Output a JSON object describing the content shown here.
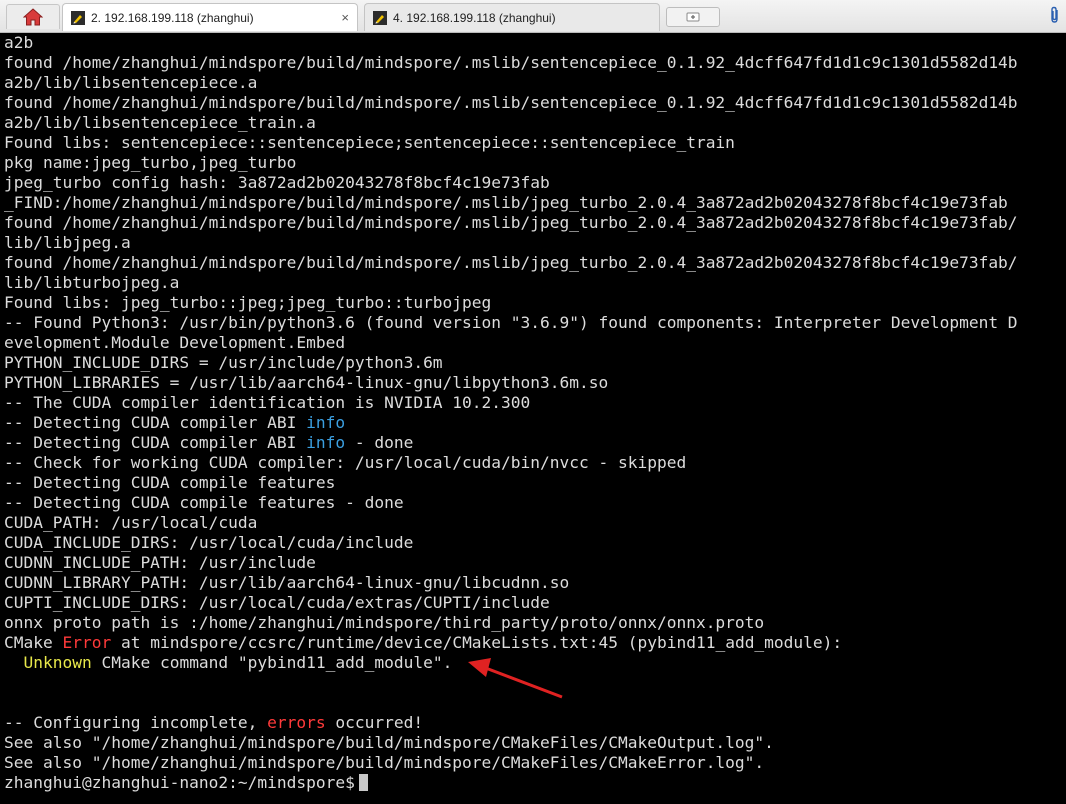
{
  "tabs": [
    {
      "label": "2. 192.168.199.118 (zhanghui)",
      "active": true,
      "close": "×"
    },
    {
      "label": "4. 192.168.199.118 (zhanghui)",
      "active": false
    }
  ],
  "icons": {
    "home": "home-icon",
    "session": "pencil-session-icon",
    "new_tab": "new-tab-icon",
    "attach": "paperclip-icon"
  },
  "colors": {
    "background": "#000000",
    "foreground": "#dcdcdc",
    "info": "#3b9fe0",
    "error": "#ff3a3a",
    "warning": "#e8e84a",
    "arrow": "#e02222"
  },
  "terminal": {
    "lines": [
      "a2b",
      "found /home/zhanghui/mindspore/build/mindspore/.mslib/sentencepiece_0.1.92_4dcff647fd1d1c9c1301d5582d14b",
      "a2b/lib/libsentencepiece.a",
      "found /home/zhanghui/mindspore/build/mindspore/.mslib/sentencepiece_0.1.92_4dcff647fd1d1c9c1301d5582d14b",
      "a2b/lib/libsentencepiece_train.a",
      "Found libs: sentencepiece::sentencepiece;sentencepiece::sentencepiece_train",
      "pkg name:jpeg_turbo,jpeg_turbo",
      "jpeg_turbo config hash: 3a872ad2b02043278f8bcf4c19e73fab",
      "_FIND:/home/zhanghui/mindspore/build/mindspore/.mslib/jpeg_turbo_2.0.4_3a872ad2b02043278f8bcf4c19e73fab",
      "found /home/zhanghui/mindspore/build/mindspore/.mslib/jpeg_turbo_2.0.4_3a872ad2b02043278f8bcf4c19e73fab/",
      "lib/libjpeg.a",
      "found /home/zhanghui/mindspore/build/mindspore/.mslib/jpeg_turbo_2.0.4_3a872ad2b02043278f8bcf4c19e73fab/",
      "lib/libturbojpeg.a",
      "Found libs: jpeg_turbo::jpeg;jpeg_turbo::turbojpeg",
      "-- Found Python3: /usr/bin/python3.6 (found version \"3.6.9\") found components: Interpreter Development D",
      "evelopment.Module Development.Embed",
      "PYTHON_INCLUDE_DIRS = /usr/include/python3.6m",
      "PYTHON_LIBRARIES = /usr/lib/aarch64-linux-gnu/libpython3.6m.so",
      "-- The CUDA compiler identification is NVIDIA 10.2.300"
    ],
    "abi_line": {
      "prefix": "-- Detecting CUDA compiler ABI ",
      "keyword": "info",
      "suffix": ""
    },
    "abi_done_line": {
      "prefix": "-- Detecting CUDA compiler ABI ",
      "keyword": "info",
      "suffix": " - done"
    },
    "lines2": [
      "-- Check for working CUDA compiler: /usr/local/cuda/bin/nvcc - skipped",
      "-- Detecting CUDA compile features",
      "-- Detecting CUDA compile features - done",
      "CUDA_PATH: /usr/local/cuda",
      "CUDA_INCLUDE_DIRS: /usr/local/cuda/include",
      "CUDNN_INCLUDE_PATH: /usr/include",
      "CUDNN_LIBRARY_PATH: /usr/lib/aarch64-linux-gnu/libcudnn.so",
      "CUPTI_INCLUDE_DIRS: /usr/local/cuda/extras/CUPTI/include",
      "onnx proto path is :/home/zhanghui/mindspore/third_party/proto/onnx/onnx.proto"
    ],
    "cmake_error": {
      "prefix": "CMake ",
      "keyword": "Error",
      "suffix": " at mindspore/ccsrc/runtime/device/CMakeLists.txt:45 (pybind11_add_module):"
    },
    "unknown_line": {
      "prefix": "  ",
      "keyword": "Unknown",
      "suffix": " CMake command \"pybind11_add_module\"."
    },
    "configuring_line": {
      "prefix": "-- Configuring incomplete, ",
      "keyword": "errors",
      "suffix": " occurred!"
    },
    "lines3": [
      "See also \"/home/zhanghui/mindspore/build/mindspore/CMakeFiles/CMakeOutput.log\".",
      "See also \"/home/zhanghui/mindspore/build/mindspore/CMakeFiles/CMakeError.log\"."
    ],
    "prompt": "zhanghui@zhanghui-nano2:~/mindspore$"
  }
}
